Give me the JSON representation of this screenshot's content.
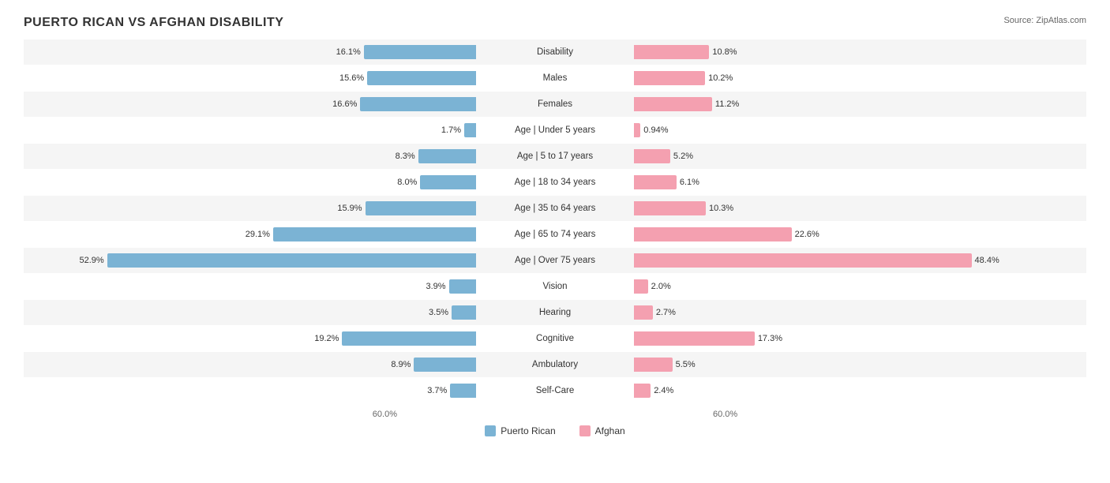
{
  "title": "PUERTO RICAN VS AFGHAN DISABILITY",
  "source": "Source: ZipAtlas.com",
  "colors": {
    "puerto_rican": "#7bb3d4",
    "afghan": "#f4a0b0"
  },
  "axis": {
    "left": "60.0%",
    "right": "60.0%"
  },
  "legend": {
    "puerto_rican": "Puerto Rican",
    "afghan": "Afghan"
  },
  "rows": [
    {
      "label": "Disability",
      "left_val": "16.1%",
      "right_val": "10.8%",
      "left_pct": 16.1,
      "right_pct": 10.8
    },
    {
      "label": "Males",
      "left_val": "15.6%",
      "right_val": "10.2%",
      "left_pct": 15.6,
      "right_pct": 10.2
    },
    {
      "label": "Females",
      "left_val": "16.6%",
      "right_val": "11.2%",
      "left_pct": 16.6,
      "right_pct": 11.2
    },
    {
      "label": "Age | Under 5 years",
      "left_val": "1.7%",
      "right_val": "0.94%",
      "left_pct": 1.7,
      "right_pct": 0.94
    },
    {
      "label": "Age | 5 to 17 years",
      "left_val": "8.3%",
      "right_val": "5.2%",
      "left_pct": 8.3,
      "right_pct": 5.2
    },
    {
      "label": "Age | 18 to 34 years",
      "left_val": "8.0%",
      "right_val": "6.1%",
      "left_pct": 8.0,
      "right_pct": 6.1
    },
    {
      "label": "Age | 35 to 64 years",
      "left_val": "15.9%",
      "right_val": "10.3%",
      "left_pct": 15.9,
      "right_pct": 10.3
    },
    {
      "label": "Age | 65 to 74 years",
      "left_val": "29.1%",
      "right_val": "22.6%",
      "left_pct": 29.1,
      "right_pct": 22.6
    },
    {
      "label": "Age | Over 75 years",
      "left_val": "52.9%",
      "right_val": "48.4%",
      "left_pct": 52.9,
      "right_pct": 48.4
    },
    {
      "label": "Vision",
      "left_val": "3.9%",
      "right_val": "2.0%",
      "left_pct": 3.9,
      "right_pct": 2.0
    },
    {
      "label": "Hearing",
      "left_val": "3.5%",
      "right_val": "2.7%",
      "left_pct": 3.5,
      "right_pct": 2.7
    },
    {
      "label": "Cognitive",
      "left_val": "19.2%",
      "right_val": "17.3%",
      "left_pct": 19.2,
      "right_pct": 17.3
    },
    {
      "label": "Ambulatory",
      "left_val": "8.9%",
      "right_val": "5.5%",
      "left_pct": 8.9,
      "right_pct": 5.5
    },
    {
      "label": "Self-Care",
      "left_val": "3.7%",
      "right_val": "2.4%",
      "left_pct": 3.7,
      "right_pct": 2.4
    }
  ],
  "max_pct": 60
}
